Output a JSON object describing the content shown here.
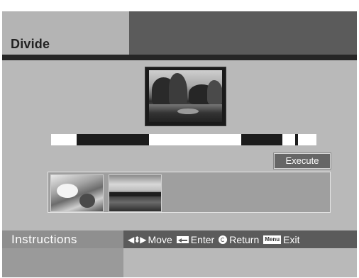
{
  "title": "Divide",
  "execute_label": "Execute",
  "instructions_label": "Instructions",
  "hints": [
    {
      "icon": "arrows-icon",
      "label": "Move"
    },
    {
      "icon": "enter-icon",
      "label": "Enter"
    },
    {
      "icon": "return-icon",
      "label": "Return"
    },
    {
      "icon": "menu-key-icon",
      "key_text": "Menu",
      "label": "Exit"
    }
  ],
  "colors": {
    "panel": "#b9b9b9",
    "title_dark": "#5b5b5b",
    "bar": "#262626",
    "button": "#666666"
  }
}
